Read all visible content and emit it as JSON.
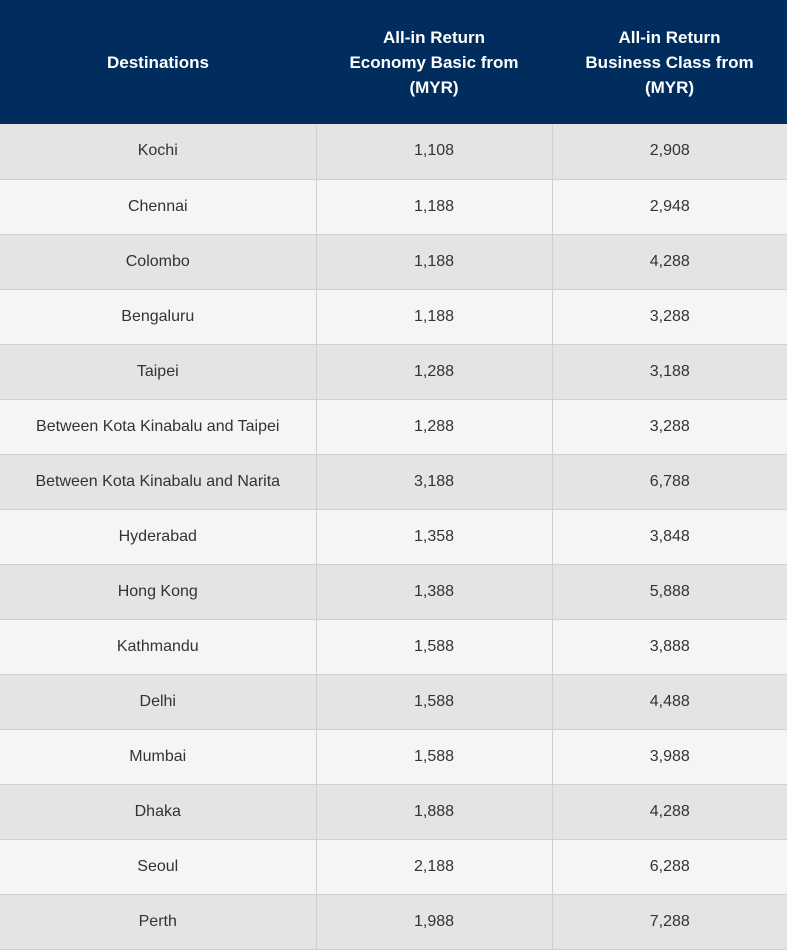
{
  "table": {
    "headers": [
      "Destinations",
      "All-in Return\nEconomy Basic  from\n(MYR)",
      "All-in Return\nBusiness Class from\n(MYR)"
    ],
    "rows": [
      [
        "Kochi",
        "1,108",
        "2,908"
      ],
      [
        "Chennai",
        "1,188",
        "2,948"
      ],
      [
        "Colombo",
        "1,188",
        "4,288"
      ],
      [
        "Bengaluru",
        "1,188",
        "3,288"
      ],
      [
        "Taipei",
        "1,288",
        "3,188"
      ],
      [
        "Between Kota Kinabalu and Taipei",
        "1,288",
        "3,288"
      ],
      [
        "Between Kota Kinabalu and Narita",
        "3,188",
        "6,788"
      ],
      [
        "Hyderabad",
        "1,358",
        "3,848"
      ],
      [
        "Hong Kong",
        "1,388",
        "5,888"
      ],
      [
        "Kathmandu",
        "1,588",
        "3,888"
      ],
      [
        "Delhi",
        "1,588",
        "4,488"
      ],
      [
        "Mumbai",
        "1,588",
        "3,988"
      ],
      [
        "Dhaka",
        "1,888",
        "4,288"
      ],
      [
        "Seoul",
        "2,188",
        "6,288"
      ],
      [
        "Perth",
        "1,988",
        "7,288"
      ]
    ]
  },
  "colors": {
    "header_bg": "#002d5d",
    "header_text": "#ffffff",
    "row_odd_bg": "#e4e4e4",
    "row_even_bg": "#f5f5f5",
    "cell_text": "#333333",
    "border": "#d0d0d0"
  }
}
